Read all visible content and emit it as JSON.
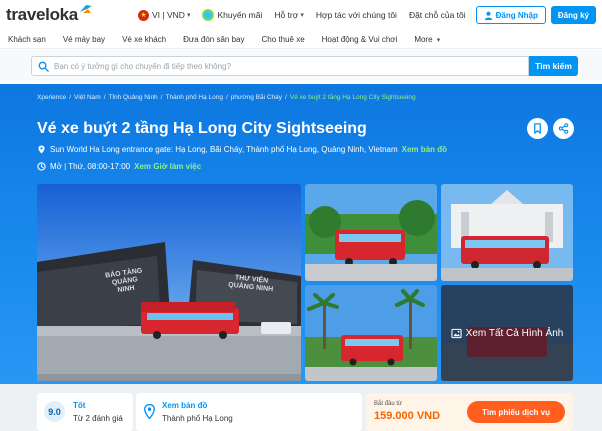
{
  "header": {
    "logo_text": "traveloka",
    "language_currency": "VI | VND",
    "promo": "Khuyến mãi",
    "support": "Hỗ trợ",
    "partner": "Hợp tác với chúng tôi",
    "my_bookings": "Đặt chỗ của tôi",
    "login": "Đăng Nhập",
    "register": "Đăng ký"
  },
  "subnav": {
    "items": [
      "Khách sạn",
      "Vé máy bay",
      "Vé xe khách",
      "Đưa đón sân bay",
      "Cho thuê xe",
      "Hoạt động & Vui chơi",
      "More"
    ]
  },
  "search": {
    "placeholder": "Bạn có ý tưởng gì cho chuyến đi tiếp theo không?",
    "value": "",
    "button": "Tìm kiếm"
  },
  "breadcrumb": [
    "Xperience",
    "Việt Nam",
    "Tỉnh Quảng Ninh",
    "Thành phố Hạ Long",
    "phường Bãi Cháy",
    "Vé xe buýt 2 tầng Hạ Long City Sightseeing"
  ],
  "product": {
    "title": "Vé xe buýt 2 tầng Hạ Long City Sightseeing",
    "address": "Sun World Ha Long entrance gate: Hạ Long, Bãi Cháy, Thành phố Hạ Long, Quảng Ninh, Vietnam",
    "map_link": "Xem bản đồ",
    "hours": "Mở | Thứ, 08:00-17:00",
    "hours_link": "Xem Giờ làm việc"
  },
  "gallery": {
    "see_all": "Xem Tất Cả Hình Ảnh",
    "main_sign_left": "BẢO TÀNG QUẢNG NINH",
    "main_sign_right": "THƯ VIỆN QUẢNG NINH"
  },
  "rating": {
    "score": "9.0",
    "label": "Tốt",
    "count": "Từ 2 đánh giá"
  },
  "location": {
    "link": "Xem bản đồ",
    "city": "Thành phố Hạ Long"
  },
  "price": {
    "label": "Bắt đầu từ",
    "value": "159.000 VND",
    "button": "Tìm phiếu dịch vụ"
  },
  "colors": {
    "brand": "#0194f3",
    "hero": "#1c8cf0",
    "accent_green": "#8ef08a",
    "price_orange": "#f56500",
    "cta_orange": "#ff5e1f"
  }
}
